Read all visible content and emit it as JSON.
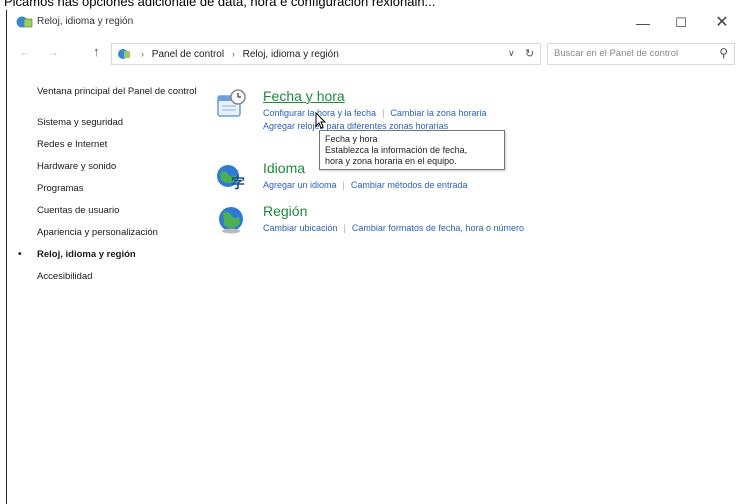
{
  "caption": "Picamos nas opciones adicionale de data, hora e configuración rexionain...",
  "window": {
    "title": "Reloj, idioma y región",
    "controls": {
      "minimize": "—",
      "maximize": "☐",
      "close": "✕"
    }
  },
  "nav": {
    "back": "←",
    "forward": "→",
    "up": "↑",
    "breadcrumbs": [
      "Panel de control",
      "Reloj, idioma y región"
    ],
    "separator": "›",
    "dropdown": "∨",
    "refresh": "↻",
    "search_placeholder": "Buscar en el Panel de control",
    "search_icon": "⚲"
  },
  "sidebar": {
    "home": "Ventana principal del Panel de control",
    "items": [
      "Sistema y seguridad",
      "Redes e Internet",
      "Hardware y sonido",
      "Programas",
      "Cuentas de usuario",
      "Apariencia y personalización",
      "Reloj, idioma y región",
      "Accesibilidad"
    ],
    "active_bullet": "•"
  },
  "categories": [
    {
      "title": "Fecha y hora",
      "links": [
        "Configurar la hora y la fecha",
        "Cambiar la zona horaria"
      ],
      "links2": [
        "Agregar relojes para diferentes zonas horarias"
      ]
    },
    {
      "title": "Idioma",
      "links": [
        "Agregar un idioma",
        "Cambiar métodos de entrada"
      ]
    },
    {
      "title": "Región",
      "links": [
        "Cambiar ubicación",
        "Cambiar formatos de fecha, hora o número"
      ]
    }
  ],
  "tooltip": {
    "title": "Fecha y hora",
    "line1": "Establezca la información de fecha,",
    "line2": "hora y zona horaria en el equipo."
  },
  "colors": {
    "category_title": "#1e8a3e",
    "link": "#2b62b6"
  }
}
